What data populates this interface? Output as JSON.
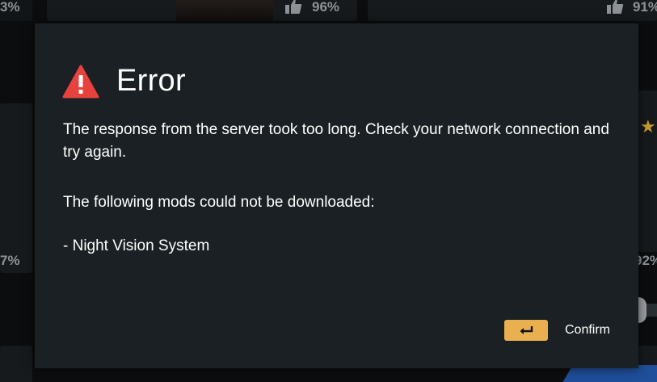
{
  "background": {
    "tiles": [
      {
        "rating": "3%"
      },
      {
        "rating": "96%"
      },
      {
        "rating": "91%"
      },
      {
        "rating": "7%"
      },
      {
        "rating": "92%"
      }
    ]
  },
  "dialog": {
    "title": "Error",
    "icon": "warning-triangle-icon",
    "icon_color": "#e8423f",
    "message": "The response from the server took too long. Check your network connection and try again.",
    "subheading": "The following mods could not be downloaded:",
    "failed_mods": [
      "- Night Vision System"
    ],
    "confirm": {
      "key_icon": "enter-key-icon",
      "key_color": "#eab04f",
      "label": "Confirm"
    }
  }
}
